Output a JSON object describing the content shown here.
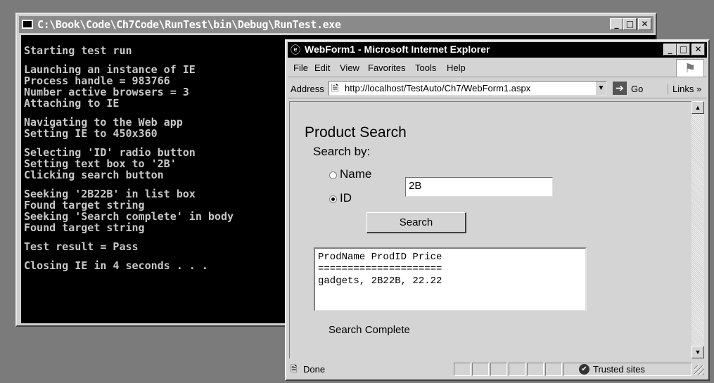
{
  "console": {
    "title": "C:\\Book\\Code\\Ch7Code\\RunTest\\bin\\Debug\\RunTest.exe",
    "lines": [
      "Starting test run",
      "",
      "Launching an instance of IE",
      "Process handle = 983766",
      "Number active browsers = 3",
      "Attaching to IE",
      "",
      "Navigating to the Web app",
      "Setting IE to 450x360",
      "",
      "Selecting 'ID' radio button",
      "Setting text box to '2B'",
      "Clicking search button",
      "",
      "Seeking '2B22B' in list box",
      "Found target string",
      "Seeking 'Search complete' in body",
      "Found target string",
      "",
      "Test result = Pass",
      "",
      "Closing IE in 4 seconds . . ."
    ]
  },
  "ie": {
    "title": "WebForm1 - Microsoft Internet Explorer",
    "menu": [
      "File",
      "Edit",
      "View",
      "Favorites",
      "Tools",
      "Help"
    ],
    "address_label": "Address",
    "address": "http://localhost/TestAuto/Ch7/WebForm1.aspx",
    "go_label": "Go",
    "links_label": "Links »",
    "status_text": "Done",
    "zone": "Trusted sites"
  },
  "page": {
    "title": "Product Search",
    "search_by": "Search by:",
    "radio_name_label": "Name",
    "radio_id_label": "ID",
    "selected_radio": "ID",
    "search_value": "2B",
    "search_button": "Search",
    "results": [
      "ProdName ProdID Price",
      "=====================",
      "gadgets, 2B22B, 22.22"
    ],
    "status_message": "Search Complete"
  },
  "icons": {
    "console_system": "console-system-icon",
    "ie_logo": "ie-logo-icon",
    "windows_flag": "windows-throbber-icon",
    "go_arrow": "go-arrow-icon",
    "page": "page-icon",
    "trusted_zone": "check-circle-icon"
  }
}
